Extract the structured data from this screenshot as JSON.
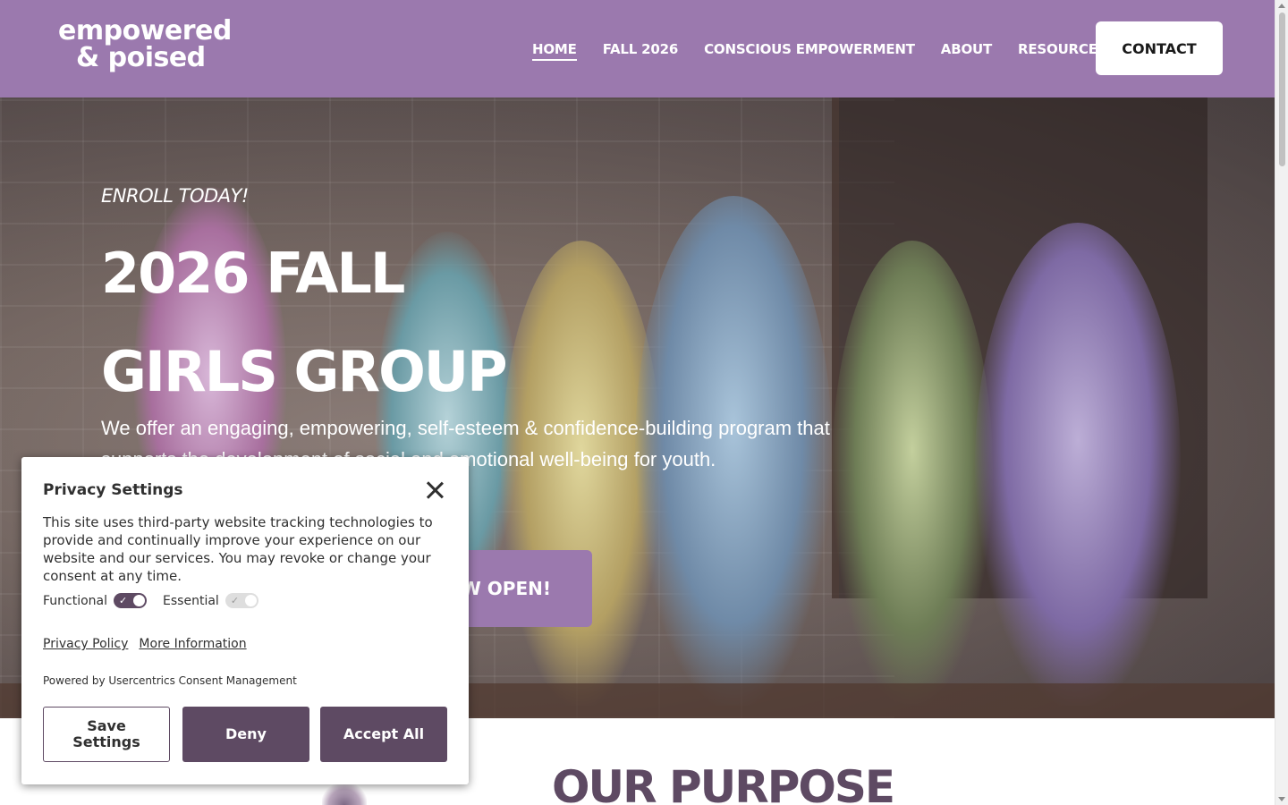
{
  "header": {
    "logo_line1": "empowered",
    "logo_line2": "& poised",
    "nav": [
      {
        "label": "HOME"
      },
      {
        "label": "FALL 2026"
      },
      {
        "label": "CONSCIOUS EMPOWERMENT"
      },
      {
        "label": "ABOUT"
      },
      {
        "label": "RESOURCES"
      }
    ],
    "contact_label": "CONTACT",
    "brand_color": "#9b79ae"
  },
  "hero": {
    "eyebrow": "ENROLL TODAY!",
    "title_line1": "2026 FALL",
    "title_line2": "GIRLS GROUP",
    "description": "We offer an engaging, empowering, self-esteem & confidence-building program that supports the development of social and emotional well-being for youth.",
    "cta_label": "W OPEN!"
  },
  "purpose": {
    "title": "OUR PURPOSE",
    "title_color": "#5e4a63"
  },
  "privacy": {
    "title": "Privacy Settings",
    "description": "This site uses third-party website tracking technologies to provide and continually improve your experience on our website and our services. You may revoke or change your consent at any time.",
    "toggles": [
      {
        "label": "Functional",
        "state": "on"
      },
      {
        "label": "Essential",
        "state": "on-disabled"
      }
    ],
    "privacy_policy_link": "Privacy Policy",
    "more_info_link": "More Information",
    "powered_by": "Powered by Usercentrics Consent Management",
    "save_label": "Save Settings",
    "deny_label": "Deny",
    "accept_label": "Accept All",
    "button_color": "#5e4a63"
  }
}
